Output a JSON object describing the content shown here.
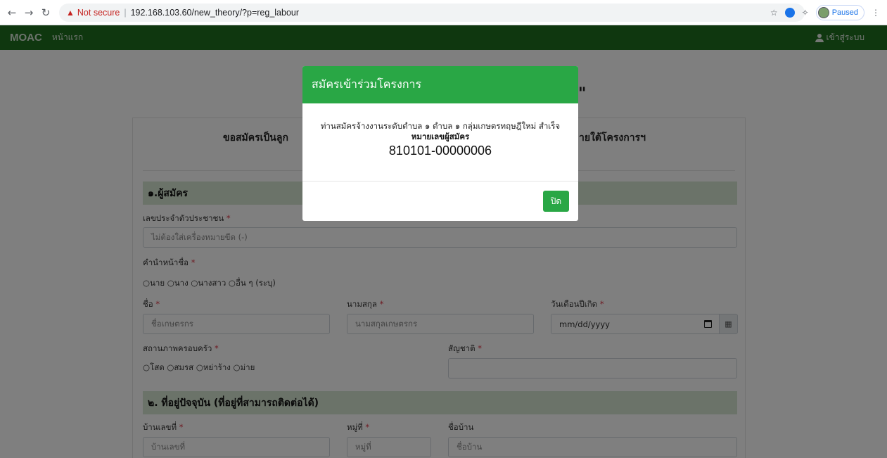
{
  "browser": {
    "security_label": "Not secure",
    "url": "192.168.103.60/new_theory/?p=reg_labour",
    "profile_status": "Paused"
  },
  "navbar": {
    "brand": "MOAC",
    "home": "หน้าแรก",
    "login": "เข้าสู่ระบบ"
  },
  "page": {
    "heading_left": "\"",
    "heading_right": "\"",
    "subheading_left": "ขอสมัครเป็นลูก",
    "subheading_right": "ายใต้โครงการฯ"
  },
  "form": {
    "section1": "๑.ผู้สมัคร",
    "id_label": "เลขประจำตัวประชาชน",
    "id_placeholder": "ไม่ต้องใส่เครื่องหมายขีด (-)",
    "prefix_label": "คำนำหน้าชื่อ",
    "prefix_options": "○นาย ○นาง ○นางสาว ○อื่น ๆ (ระบุ)",
    "name_label": "ชื่อ",
    "name_placeholder": "ชื่อเกษตรกร",
    "surname_label": "นามสกุล",
    "surname_placeholder": "นามสกุลเกษตรกร",
    "birth_label": "วันเดือนปีเกิด",
    "birth_placeholder": "mm/dd/yyyy",
    "marital_label": "สถานภาพครอบครัว",
    "marital_options": "○โสด ○สมรส ○หย่าร้าง ○ม่าย",
    "nationality_label": "สัญชาติ",
    "section2": "๒. ที่อยู่ปัจจุบัน (ที่อยู่ที่สามารถติดต่อได้)",
    "house_label": "บ้านเลขที่",
    "house_placeholder": "บ้านเลขที่",
    "moo_label": "หมู่ที่",
    "moo_placeholder": "หมู่ที่",
    "village_label": "ชื่อบ้าน",
    "village_placeholder": "ชื่อบ้าน",
    "required_mark": "*"
  },
  "modal": {
    "title": "สมัครเข้าร่วมโครงการ",
    "message": "ท่านสมัครจ้างงานระดับตำบล ๑ ตำบล ๑ กลุ่มเกษตรทฤษฎีใหม่ สำเร็จ",
    "number_label": "หมายเลขผู้สมัคร",
    "number": "810101-00000006",
    "close_label": "ปิด"
  }
}
